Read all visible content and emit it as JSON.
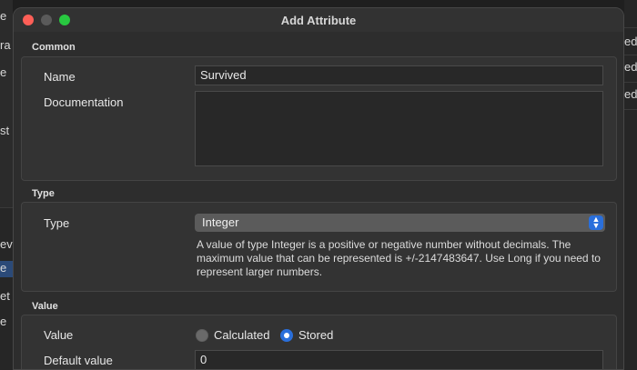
{
  "background": {
    "left_fragments": [
      "e",
      "ra",
      "e",
      "st",
      "ev",
      "e",
      "et",
      "e"
    ],
    "right_fragments": [
      "ed",
      "ed",
      "ed"
    ]
  },
  "window": {
    "title": "Add Attribute",
    "close_color": "#fe5f57",
    "maximize_color": "#28c840"
  },
  "common": {
    "section_label": "Common",
    "name_label": "Name",
    "name_value": "Survived",
    "documentation_label": "Documentation",
    "documentation_value": ""
  },
  "type_section": {
    "section_label": "Type",
    "type_label": "Type",
    "selected_type": "Integer",
    "description": "A value of type Integer is a positive or negative number without decimals. The maximum value that can be represented is +/-2147483647. Use Long if you need to represent larger numbers."
  },
  "value_section": {
    "section_label": "Value",
    "value_label": "Value",
    "options": [
      "Calculated",
      "Stored"
    ],
    "selected_option": "Stored",
    "default_value_label": "Default value",
    "default_value": "0"
  },
  "colors": {
    "accent": "#2a6fdb",
    "dialog_bg": "#2d2d2d"
  }
}
